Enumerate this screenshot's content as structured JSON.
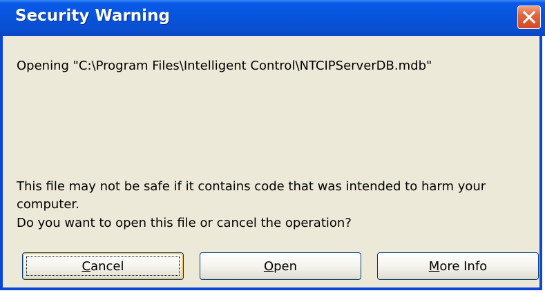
{
  "window": {
    "title": "Security Warning",
    "close_icon": "close-icon"
  },
  "message": {
    "opening": "Opening \"C:\\Program Files\\Intelligent Control\\NTCIPServerDB.mdb\"",
    "warning_line1": "This file may not be safe if it contains code that was intended to harm your",
    "warning_line2": "computer.",
    "warning_line3": "Do you want to open this file or cancel the operation?"
  },
  "buttons": {
    "cancel": {
      "mnemonic": "C",
      "rest": "ancel"
    },
    "open": {
      "mnemonic": "O",
      "rest": "pen"
    },
    "more_info": {
      "mnemonic": "M",
      "rest": "ore Info"
    }
  },
  "colors": {
    "titlebar": "#0754dc",
    "dialog_background": "#ece9d8",
    "close_button": "#d44a25"
  }
}
